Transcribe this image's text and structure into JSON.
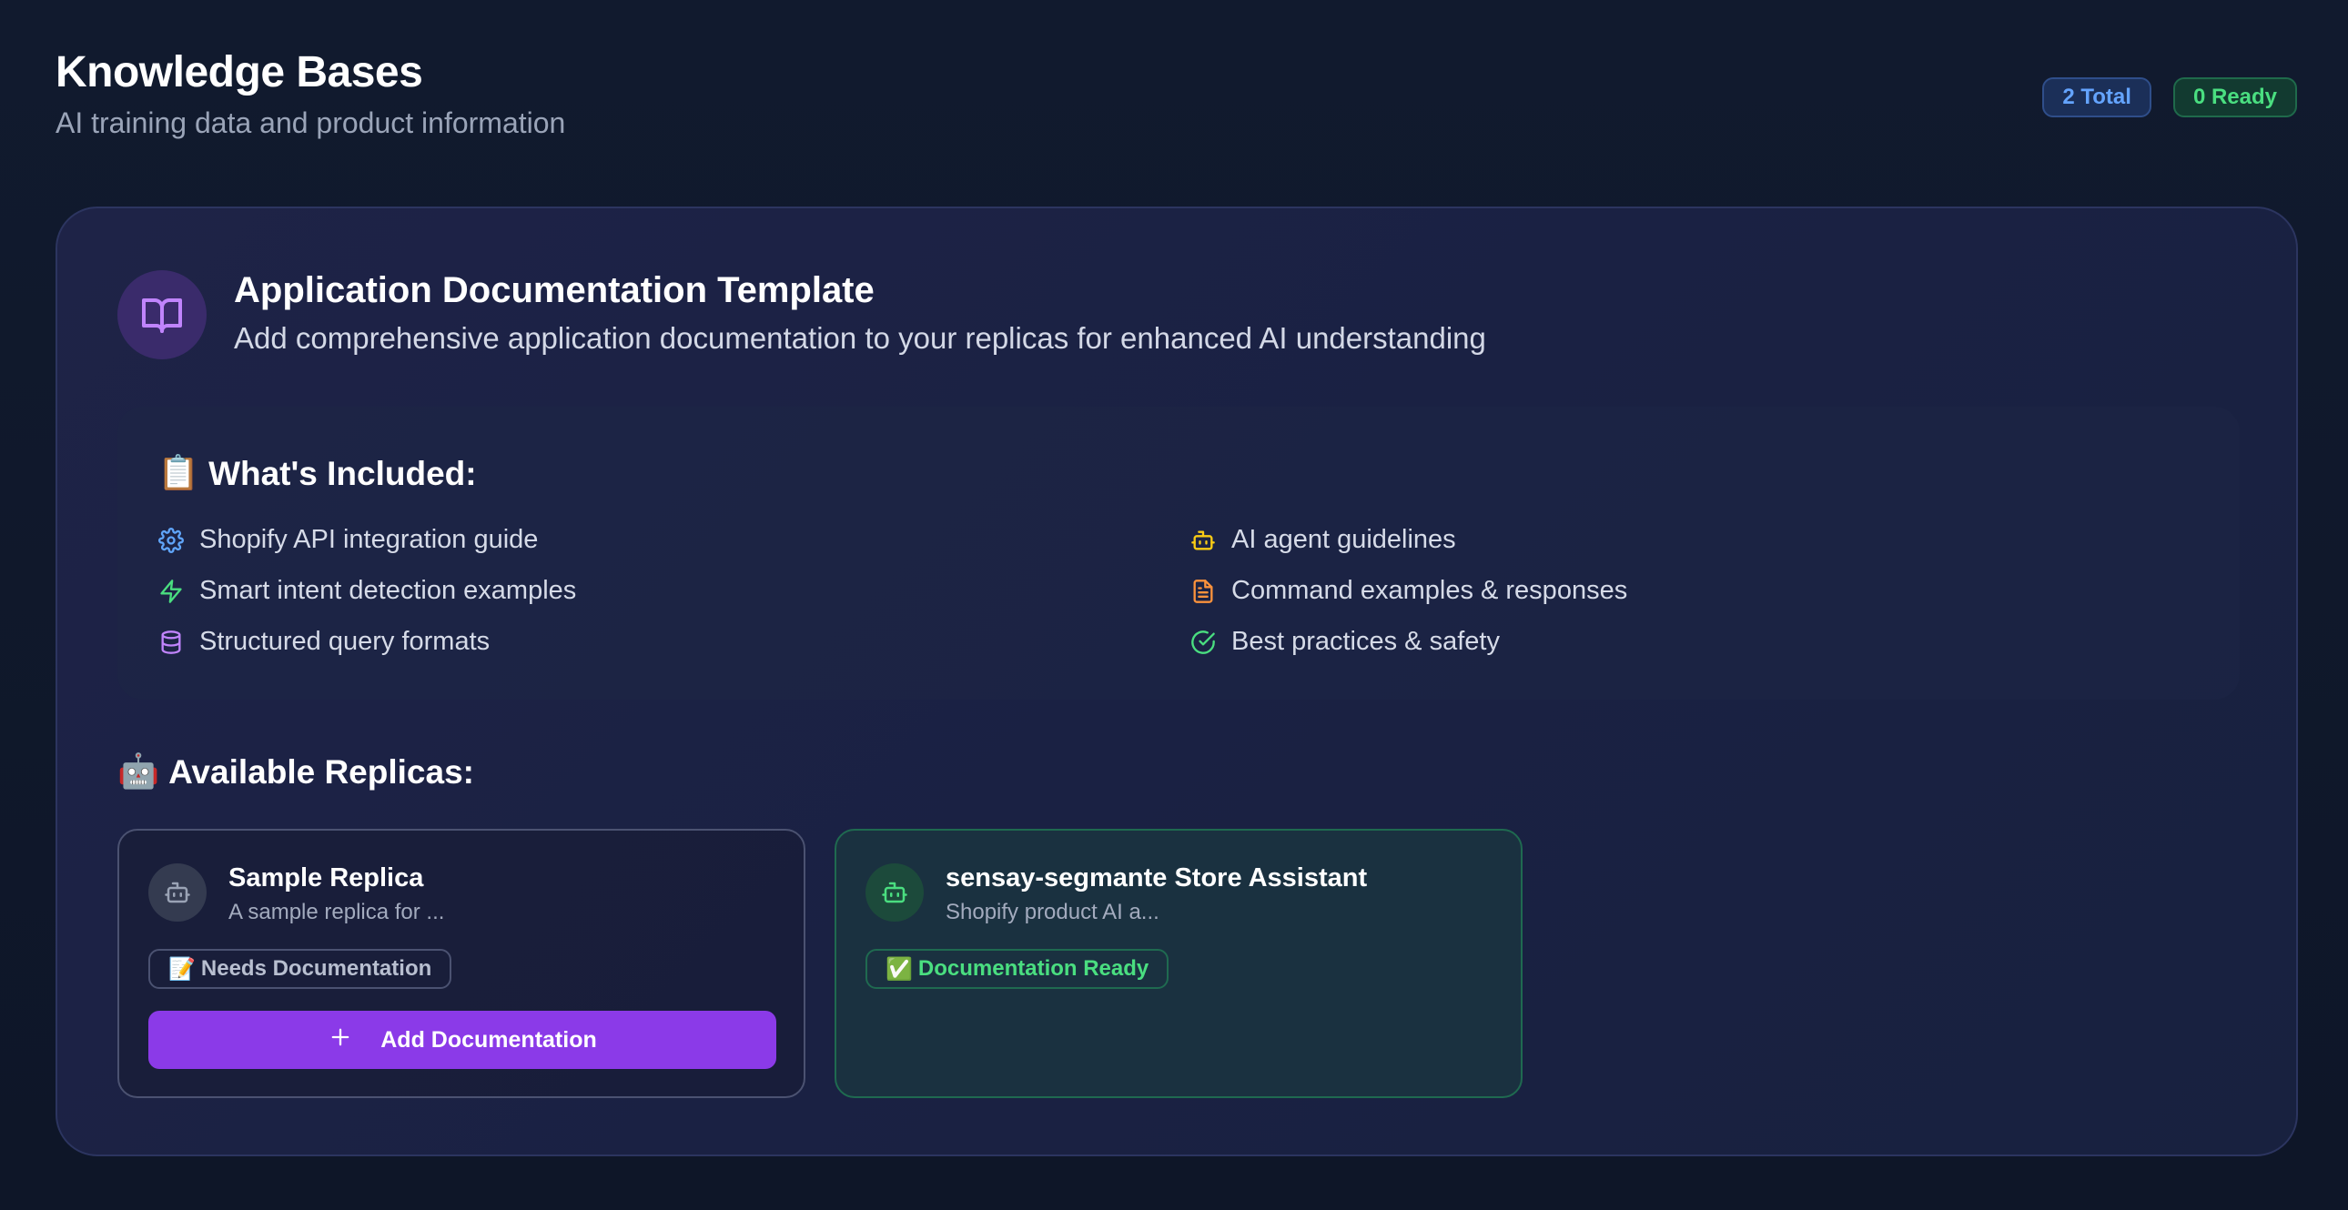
{
  "header": {
    "title": "Knowledge Bases",
    "subtitle": "AI training data and product information",
    "badges": {
      "total": "2 Total",
      "ready": "0 Ready"
    }
  },
  "template": {
    "icon": "book-open-icon",
    "title": "Application Documentation Template",
    "description": "Add comprehensive application documentation to your replicas for enhanced AI understanding",
    "included": {
      "emoji": "📋",
      "title": "What's Included:",
      "features": [
        {
          "label": "Shopify API integration guide",
          "icon": "gear-icon",
          "color": "#60a5fa"
        },
        {
          "label": "Smart intent detection examples",
          "icon": "lightning-icon",
          "color": "#4ade80"
        },
        {
          "label": "Structured query formats",
          "icon": "database-icon",
          "color": "#c084fc"
        },
        {
          "label": "AI agent guidelines",
          "icon": "robot-icon",
          "color": "#facc15"
        },
        {
          "label": "Command examples & responses",
          "icon": "document-icon",
          "color": "#fb923c"
        },
        {
          "label": "Best practices & safety",
          "icon": "check-circle-icon",
          "color": "#4ade80"
        }
      ]
    }
  },
  "replicas": {
    "emoji": "🤖",
    "title": "Available Replicas:",
    "items": [
      {
        "name": "Sample Replica",
        "description": "A sample replica for ...",
        "status_emoji": "📝",
        "status": "Needs Documentation",
        "action": "Add Documentation"
      },
      {
        "name": "sensay-segmante Store Assistant",
        "description": "Shopify product AI a...",
        "status_emoji": "✅",
        "status": "Documentation Ready"
      }
    ]
  },
  "colors": {
    "accent_purple": "#8b3ae8",
    "ready_green": "#4ade80",
    "total_blue": "#64a4ff",
    "background": "#111a2e"
  }
}
